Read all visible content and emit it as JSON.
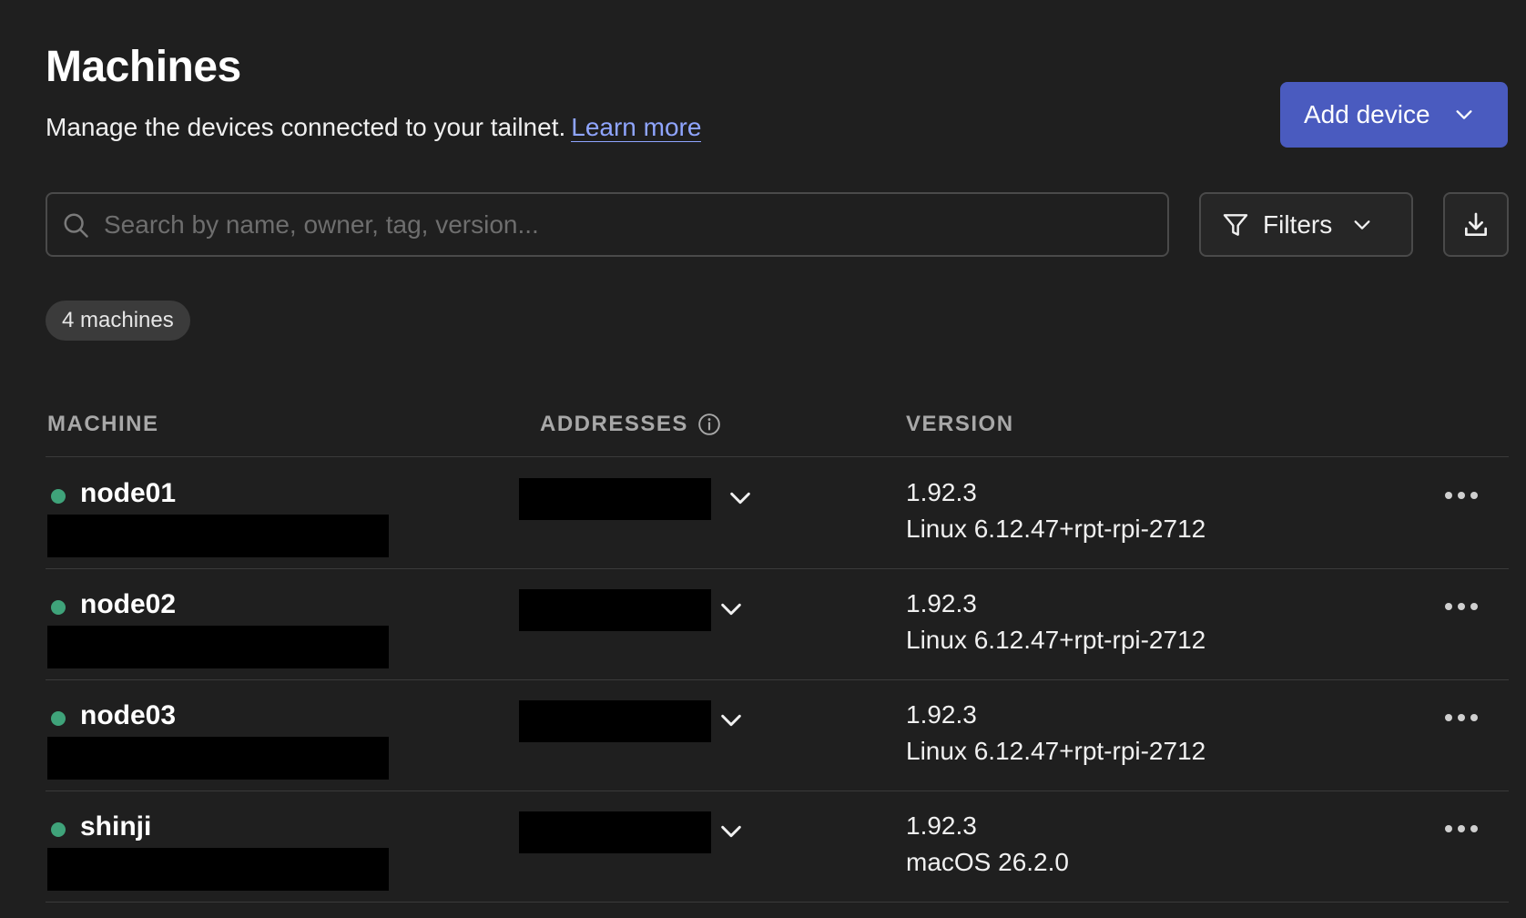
{
  "header": {
    "title": "Machines",
    "subtitle": "Manage the devices connected to your tailnet.",
    "learn_more": "Learn more",
    "add_device_label": "Add device"
  },
  "search": {
    "placeholder": "Search by name, owner, tag, version...",
    "value": ""
  },
  "filters": {
    "label": "Filters"
  },
  "count_badge": "4 machines",
  "table": {
    "columns": {
      "machine": "MACHINE",
      "addresses": "ADDRESSES",
      "version": "VERSION"
    },
    "rows": [
      {
        "name": "node01",
        "status": "online",
        "version": "1.92.3",
        "os": "Linux 6.12.47+rpt-rpi-2712"
      },
      {
        "name": "node02",
        "status": "online",
        "version": "1.92.3",
        "os": "Linux 6.12.47+rpt-rpi-2712"
      },
      {
        "name": "node03",
        "status": "online",
        "version": "1.92.3",
        "os": "Linux 6.12.47+rpt-rpi-2712"
      },
      {
        "name": "shinji",
        "status": "online",
        "version": "1.92.3",
        "os": "macOS 26.2.0"
      }
    ]
  },
  "colors": {
    "background": "#1f1f1f",
    "accent": "#4a5bbf",
    "link": "#8fa5ff",
    "online": "#3fa37a"
  },
  "icons": [
    "search-icon",
    "filter-icon",
    "chevron-down-icon",
    "download-icon",
    "info-icon",
    "more-icon"
  ]
}
